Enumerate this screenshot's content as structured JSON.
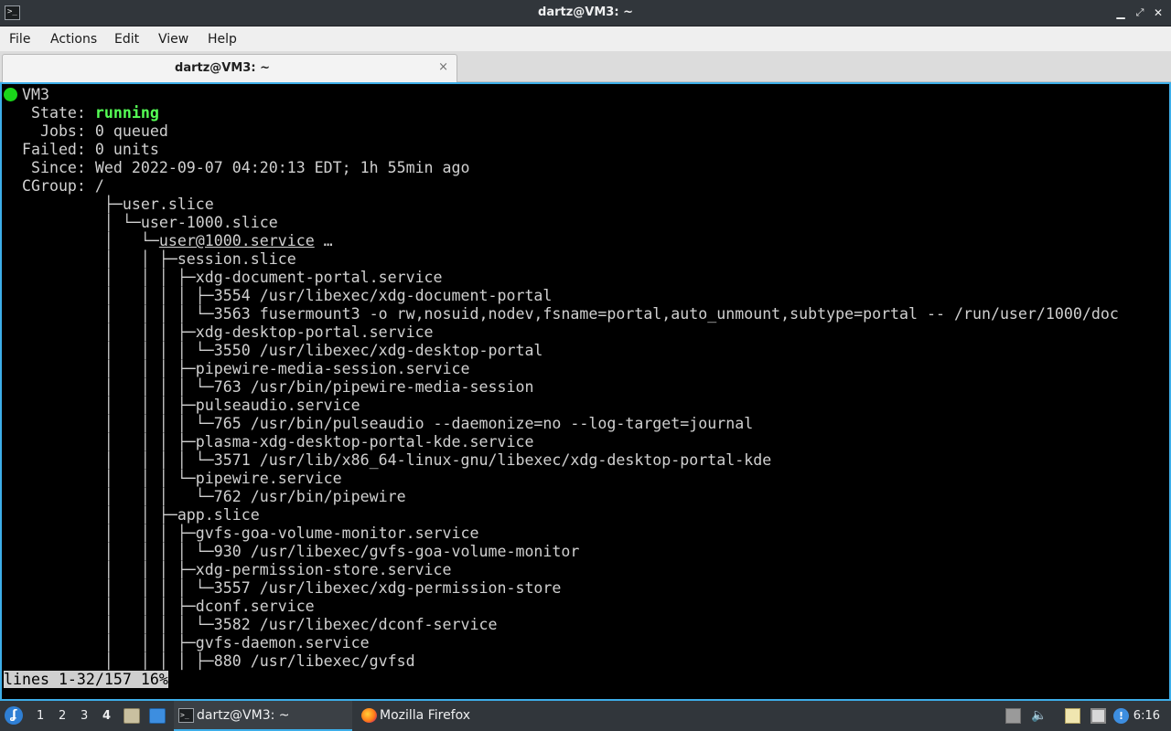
{
  "window": {
    "title": "dartz@VM3: ~",
    "icon": "terminal-icon",
    "controls": [
      "minimize-icon",
      "maximize-icon",
      "close-icon"
    ]
  },
  "menu": [
    "File",
    "Actions",
    "Edit",
    "View",
    "Help"
  ],
  "tab": {
    "label": "dartz@VM3: ~",
    "close_glyph": "×"
  },
  "terminal": {
    "host_line": "VM3",
    "status_color": "#1ad61a",
    "state_label": "   State: ",
    "state_value": "running",
    "jobs": "    Jobs: 0 queued",
    "failed": "  Failed: 0 units",
    "since": "   Since: Wed 2022-09-07 04:20:13 EDT; 1h 55min ago",
    "cgroup": "  CGroup: /",
    "user_service_prefix": "           │   └─",
    "user_service_name": "user@1000.service",
    "user_service_suffix": " …",
    "tree": [
      "           ├─user.slice",
      "           │ └─user-1000.slice",
      "           │   │ ├─session.slice",
      "           │   │ │ ├─xdg-document-portal.service",
      "           │   │ │ │ ├─3554 /usr/libexec/xdg-document-portal",
      "           │   │ │ │ └─3563 fusermount3 -o rw,nosuid,nodev,fsname=portal,auto_unmount,subtype=portal -- /run/user/1000/doc",
      "           │   │ │ ├─xdg-desktop-portal.service",
      "           │   │ │ │ └─3550 /usr/libexec/xdg-desktop-portal",
      "           │   │ │ ├─pipewire-media-session.service",
      "           │   │ │ │ └─763 /usr/bin/pipewire-media-session",
      "           │   │ │ ├─pulseaudio.service",
      "           │   │ │ │ └─765 /usr/bin/pulseaudio --daemonize=no --log-target=journal",
      "           │   │ │ ├─plasma-xdg-desktop-portal-kde.service",
      "           │   │ │ │ └─3571 /usr/lib/x86_64-linux-gnu/libexec/xdg-desktop-portal-kde",
      "           │   │ │ └─pipewire.service",
      "           │   │ │   └─762 /usr/bin/pipewire",
      "           │   │ ├─app.slice",
      "           │   │ │ ├─gvfs-goa-volume-monitor.service",
      "           │   │ │ │ └─930 /usr/libexec/gvfs-goa-volume-monitor",
      "           │   │ │ ├─xdg-permission-store.service",
      "           │   │ │ │ └─3557 /usr/libexec/xdg-permission-store",
      "           │   │ │ ├─dconf.service",
      "           │   │ │ │ └─3582 /usr/libexec/dconf-service",
      "           │   │ │ ├─gvfs-daemon.service",
      "           │   │ │ │ ├─880 /usr/libexec/gvfsd"
    ],
    "pager": "lines 1-32/157 16%"
  },
  "taskbar": {
    "start_icon": "lubuntu-start-icon",
    "workspaces": [
      "1",
      "2",
      "3",
      "4"
    ],
    "active_workspace": "4",
    "quicklaunch": [
      "file-manager-icon",
      "show-desktop-icon"
    ],
    "tasks": [
      {
        "label": "dartz@VM3: ~",
        "icon": "terminal-icon",
        "active": true
      },
      {
        "label": "Mozilla Firefox",
        "icon": "firefox-icon",
        "active": false
      }
    ],
    "tray": [
      "disk-icon",
      "volume-icon",
      "clipboard-icon",
      "display-icon",
      "update-notifier-icon"
    ],
    "clock": "6:16"
  }
}
